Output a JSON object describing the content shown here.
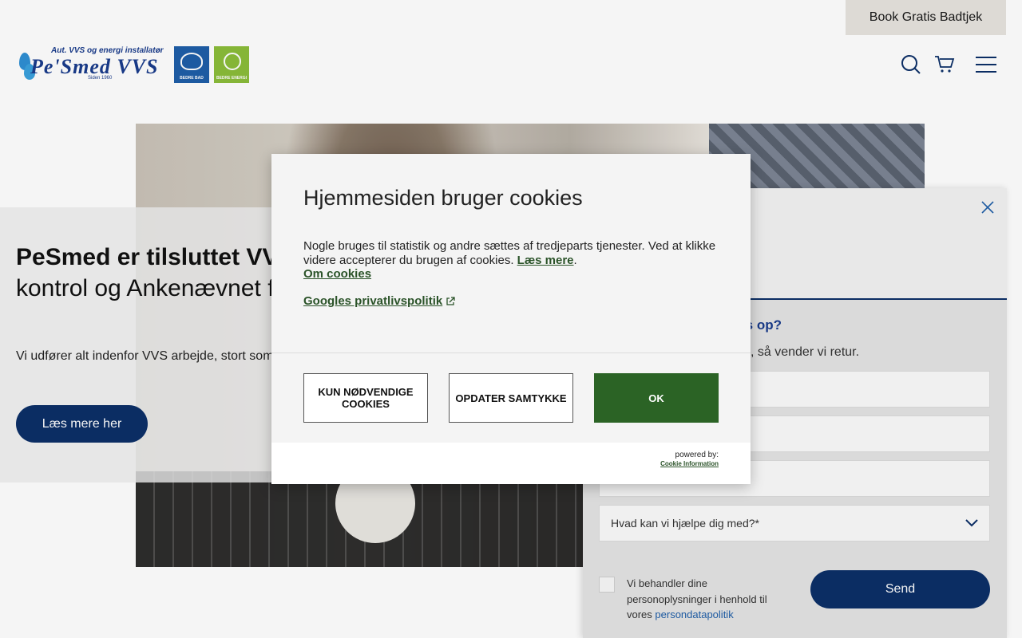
{
  "topbar": {
    "book_label": "Book Gratis Badtjek"
  },
  "logo": {
    "line1": "Aut. VVS og energi installatør",
    "name": "Pe'Smed VVS",
    "line3": "Siden 1960",
    "badge_bad": "BEDRE BAD",
    "badge_energi": "BEDRE ENERGI"
  },
  "header_icons": [
    "search-icon",
    "cart-icon",
    "menu-icon"
  ],
  "hero": {
    "title_bold": "PeSmed er tilsluttet VVS",
    "title_rest": "kontrol og Ankenævnet f installationer.",
    "text": "Vi udfører alt indenfor VVS arbejde, stort som erfaring.",
    "button": "Læs mere her"
  },
  "side_panel": {
    "question": "s op?",
    "subtext": ", så vender vi retur.",
    "select_label": "Hvad kan vi hjælpe dig med?*",
    "consent_text": "Vi behandler dine personoplysninger i henhold til vores ",
    "consent_link": "persondatapolitik",
    "send_label": "Send"
  },
  "cookie": {
    "title": "Hjemmesiden bruger cookies",
    "body": "Nogle bruges til statistik og andre sættes af tredjeparts tjenester. Ved at klikke videre accepterer du brugen af cookies. ",
    "read_more": "Læs mere",
    "about": "Om cookies",
    "google": "Googles privatlivspolitik",
    "btn_necessary": "KUN NØDVENDIGE COOKIES",
    "btn_update": "OPDATER SAMTYKKE",
    "btn_ok": "OK",
    "powered_by": "powered by:",
    "provider": "Cookie Information"
  },
  "colors": {
    "navy": "#0c2f68",
    "cookie_green": "#2b6325",
    "link_green": "#2b5329",
    "book_bg": "#e6e3de"
  }
}
